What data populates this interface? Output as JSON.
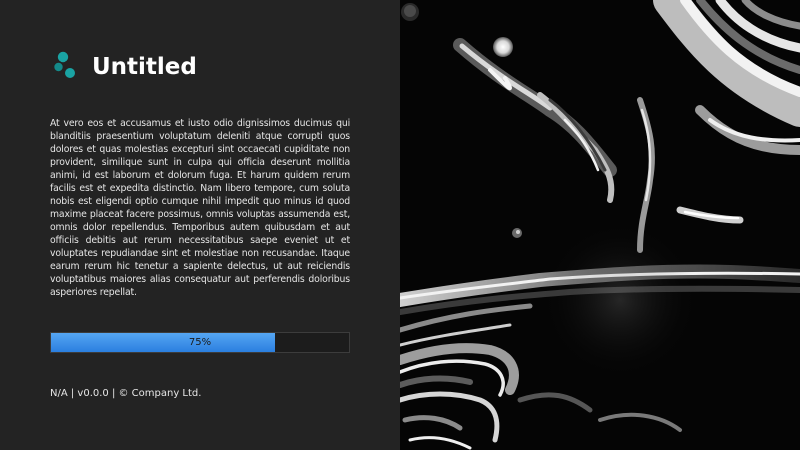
{
  "app": {
    "title": "Untitled",
    "accent_color": "#1aa3a3",
    "logo_icon": "molecule-dots-icon"
  },
  "description": "At vero eos et accusamus et iusto odio dignissimos ducimus qui blanditiis praesentium voluptatum deleniti atque corrupti quos dolores et quas molestias excepturi sint occaecati cupiditate non provident, similique sunt in culpa qui officia deserunt mollitia animi, id est laborum et dolorum fuga. Et harum quidem rerum facilis est et expedita distinctio. Nam libero tempore, cum soluta nobis est eligendi optio cumque nihil impedit quo minus id quod maxime placeat facere possimus, omnis voluptas assumenda est, omnis dolor repellendus. Temporibus autem quibusdam et aut officiis debitis aut rerum necessitatibus saepe eveniet ut et voluptates repudiandae sint et molestiae non recusandae. Itaque earum rerum hic tenetur a sapiente delectus, ut aut reiciendis voluptatibus maiores alias consequatur aut perferendis doloribus asperiores repellat.",
  "progress": {
    "percent": 75,
    "label": "75%",
    "fill_color": "#3a8fe8"
  },
  "footer": {
    "text": "N/A | v0.0.0 | © Company Ltd."
  },
  "image": {
    "subject": "abstract-fluid-marble-image"
  }
}
